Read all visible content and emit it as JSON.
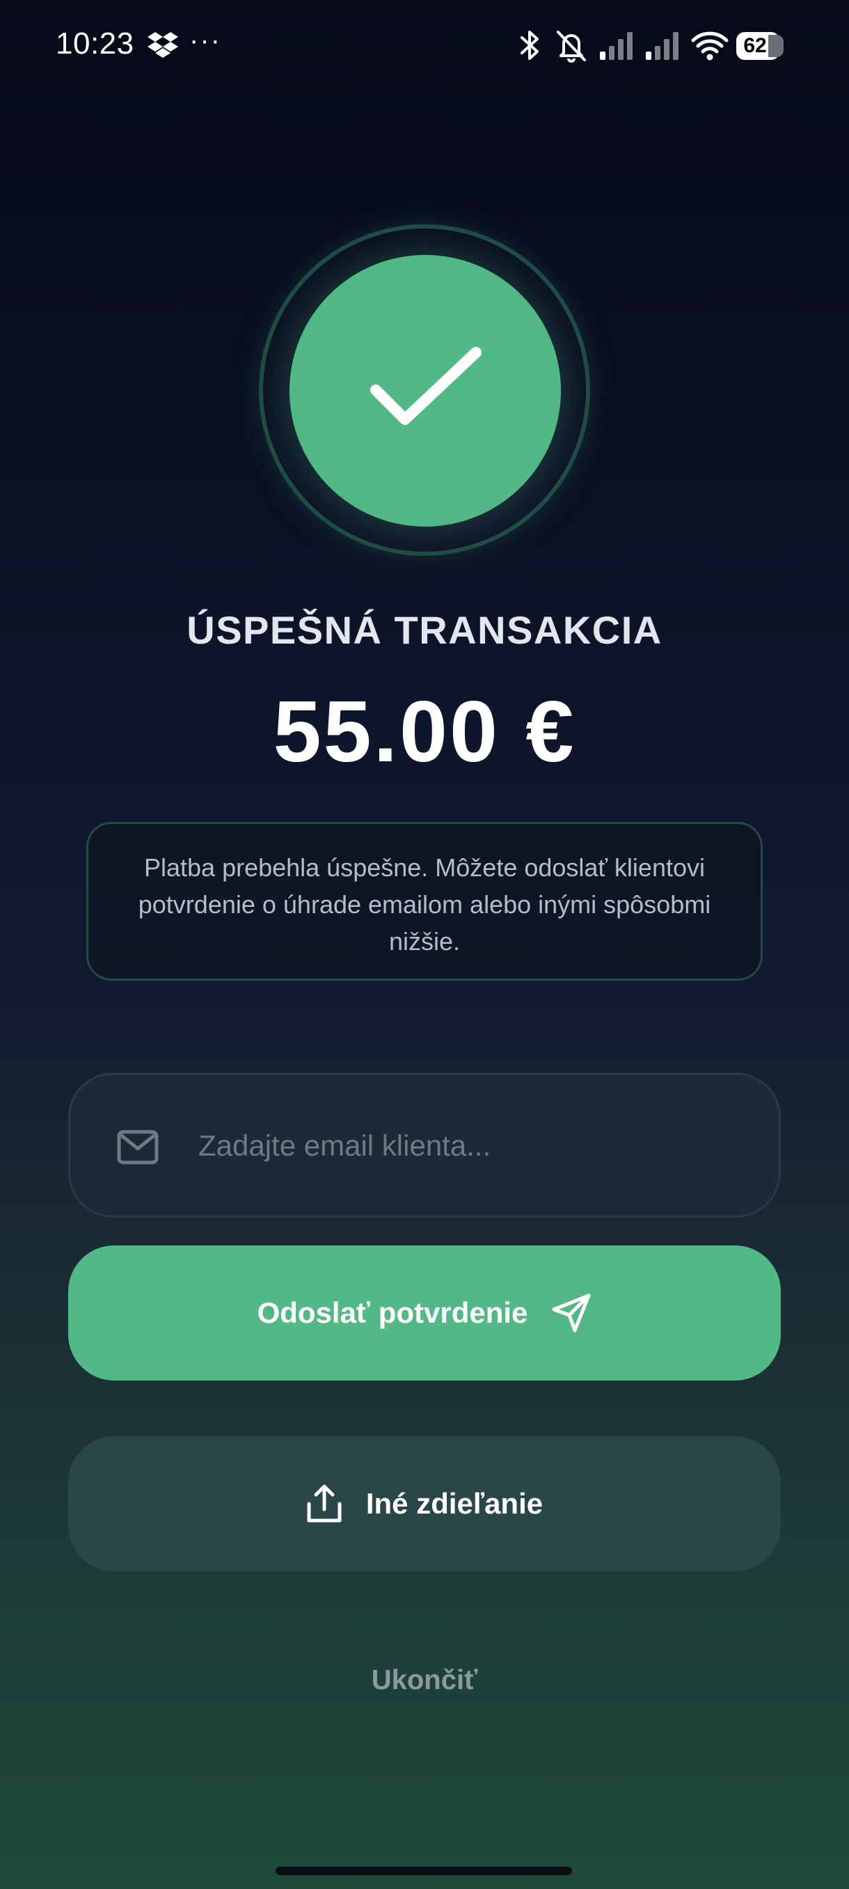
{
  "status_bar": {
    "time": "10:23",
    "more": "···",
    "battery_level": "62",
    "icons": [
      "dropbox-icon",
      "bluetooth-icon",
      "bell-muted-icon",
      "signal-icon",
      "signal-icon",
      "wifi-icon",
      "battery-icon"
    ]
  },
  "result": {
    "title": "ÚSPEŠNÁ TRANSAKCIA",
    "amount": "55.00 €",
    "message": "Platba prebehla úspešne. Môžete odoslať klientovi potvrdenie o úhrade emailom alebo inými spôsobmi nižšie."
  },
  "email": {
    "value": "",
    "placeholder": "Zadajte email klienta..."
  },
  "actions": {
    "send_label": "Odoslať potvrdenie",
    "share_label": "Iné zdieľanie",
    "finish_label": "Ukončiť"
  },
  "colors": {
    "accent": "#52b886",
    "secondary_button": "#2b4648",
    "background_top": "#060a19",
    "background_bottom": "#1f4a3a"
  }
}
